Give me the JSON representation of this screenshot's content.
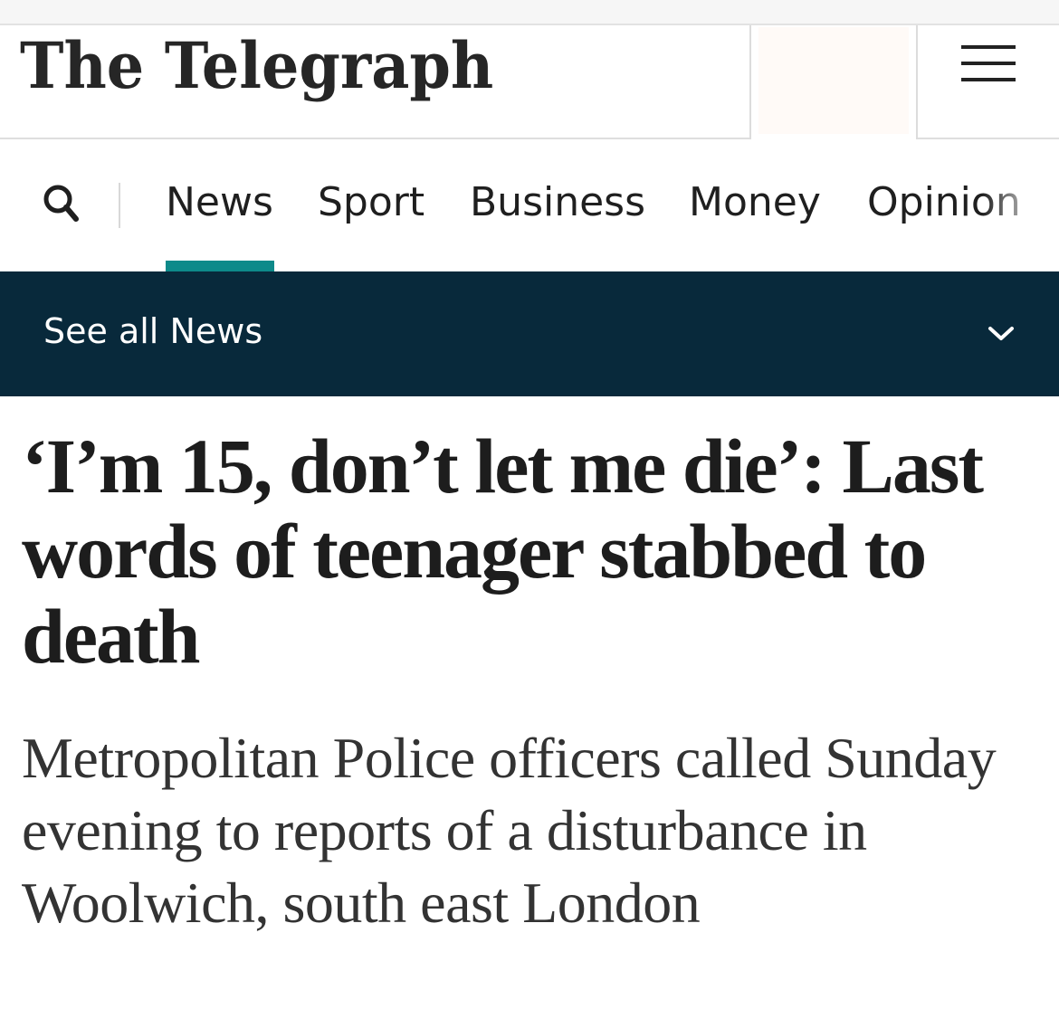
{
  "masthead": {
    "logo_text": "The Telegraph",
    "menu_icon": "hamburger-menu-icon"
  },
  "nav": {
    "search_icon": "search-icon",
    "items": [
      {
        "label": "News",
        "active": true
      },
      {
        "label": "Sport",
        "active": false
      },
      {
        "label": "Business",
        "active": false
      },
      {
        "label": "Money",
        "active": false
      },
      {
        "label": "Opinion",
        "active": false
      }
    ],
    "active_color": "#0e8a8a"
  },
  "subnav": {
    "label": "See all News",
    "chevron_icon": "chevron-down-icon",
    "background": "#08293b"
  },
  "article": {
    "headline": "‘I’m 15, don’t let me die’: Last words of teenager stabbed to death",
    "standfirst": "Metropolitan Police officers called Sunday evening to reports of a disturbance in Woolwich, south east London"
  }
}
